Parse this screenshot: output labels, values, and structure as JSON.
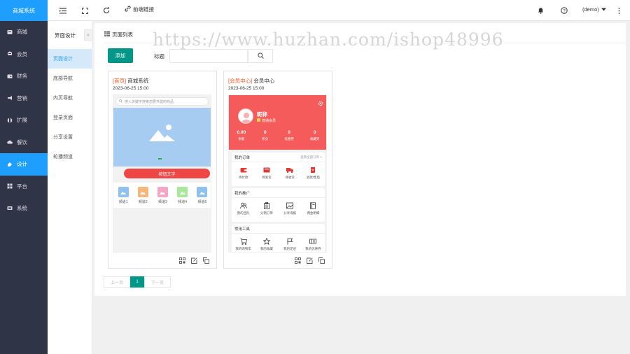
{
  "app": {
    "brand": "商城系统"
  },
  "sidebar": {
    "items": [
      {
        "label": "商城",
        "icon": "store-icon"
      },
      {
        "label": "会员",
        "icon": "member-icon"
      },
      {
        "label": "财务",
        "icon": "wallet-icon"
      },
      {
        "label": "营销",
        "icon": "megaphone-icon"
      },
      {
        "label": "扩展",
        "icon": "puzzle-icon"
      },
      {
        "label": "餐饮",
        "icon": "cloud-icon"
      },
      {
        "label": "设计",
        "icon": "design-icon",
        "active": true
      },
      {
        "label": "平台",
        "icon": "grid-icon"
      },
      {
        "label": "系统",
        "icon": "system-icon"
      }
    ]
  },
  "topbar": {
    "front_link": "前端链接",
    "user": "(demo)"
  },
  "submenu": {
    "title": "界面设计",
    "items": [
      {
        "label": "页面设计",
        "active": true
      },
      {
        "label": "底部导航"
      },
      {
        "label": "内页导航"
      },
      {
        "label": "登录页面"
      },
      {
        "label": "分享设置"
      },
      {
        "label": "轮播频道"
      }
    ]
  },
  "main": {
    "title": "页面列表",
    "add_label": "添加",
    "filter_label": "标题",
    "filter_value": ""
  },
  "cards": [
    {
      "tag": "[首页]",
      "name": "商城系统",
      "date": "2023-06-25 15:00",
      "search_placeholder": "搜入关键字搜索您要共建的商品",
      "button_text": "按钮文字",
      "nav": [
        {
          "label": "频道1",
          "color": "#8fc1ee"
        },
        {
          "label": "频道2",
          "color": "#f4b87d"
        },
        {
          "label": "频道3",
          "color": "#f3a7c2"
        },
        {
          "label": "频道4",
          "color": "#a8e89a"
        },
        {
          "label": "频道5",
          "color": "#8fc1ee"
        }
      ]
    },
    {
      "tag": "[会员中心]",
      "name": "会员中心",
      "date": "2023-06-25 15:00",
      "nickname": "昵称",
      "member_level": "普通会员",
      "stats": [
        {
          "value": "0.00",
          "label": "余额"
        },
        {
          "value": "0",
          "label": "积分"
        },
        {
          "value": "0",
          "label": "优惠券"
        },
        {
          "value": "0",
          "label": "收藏夹"
        }
      ],
      "orders": {
        "title": "我的订单",
        "more": "查看全部订单 >",
        "items": [
          {
            "label": "待付款",
            "icon": "wallet-icon"
          },
          {
            "label": "待发货",
            "icon": "box-icon"
          },
          {
            "label": "待收货",
            "icon": "truck-icon"
          },
          {
            "label": "退款/售后",
            "icon": "refund-icon"
          }
        ]
      },
      "promo": {
        "title": "我的推广",
        "items": [
          {
            "label": "我的团队",
            "icon": "team-icon"
          },
          {
            "label": "分销订单",
            "icon": "clipboard-icon"
          },
          {
            "label": "分享海报",
            "icon": "image-icon"
          },
          {
            "label": "佣金明细",
            "icon": "book-icon"
          }
        ]
      },
      "tools": {
        "title": "常用工具",
        "items": [
          {
            "label": "我的购物车",
            "icon": "cart-icon"
          },
          {
            "label": "我的收藏",
            "icon": "star-icon"
          },
          {
            "label": "我的足迹",
            "icon": "flag-icon"
          },
          {
            "label": "我的优惠券",
            "icon": "ticket-icon"
          }
        ]
      }
    }
  ],
  "pagination": {
    "prev": "上一页",
    "current": "1",
    "next": "下一页"
  },
  "watermark": "https://www.huzhan.com/ishop48996",
  "colors": {
    "primary": "#1e9fff",
    "sidebar": "#2f3447",
    "accent": "#009688",
    "danger": "#ef4646"
  }
}
